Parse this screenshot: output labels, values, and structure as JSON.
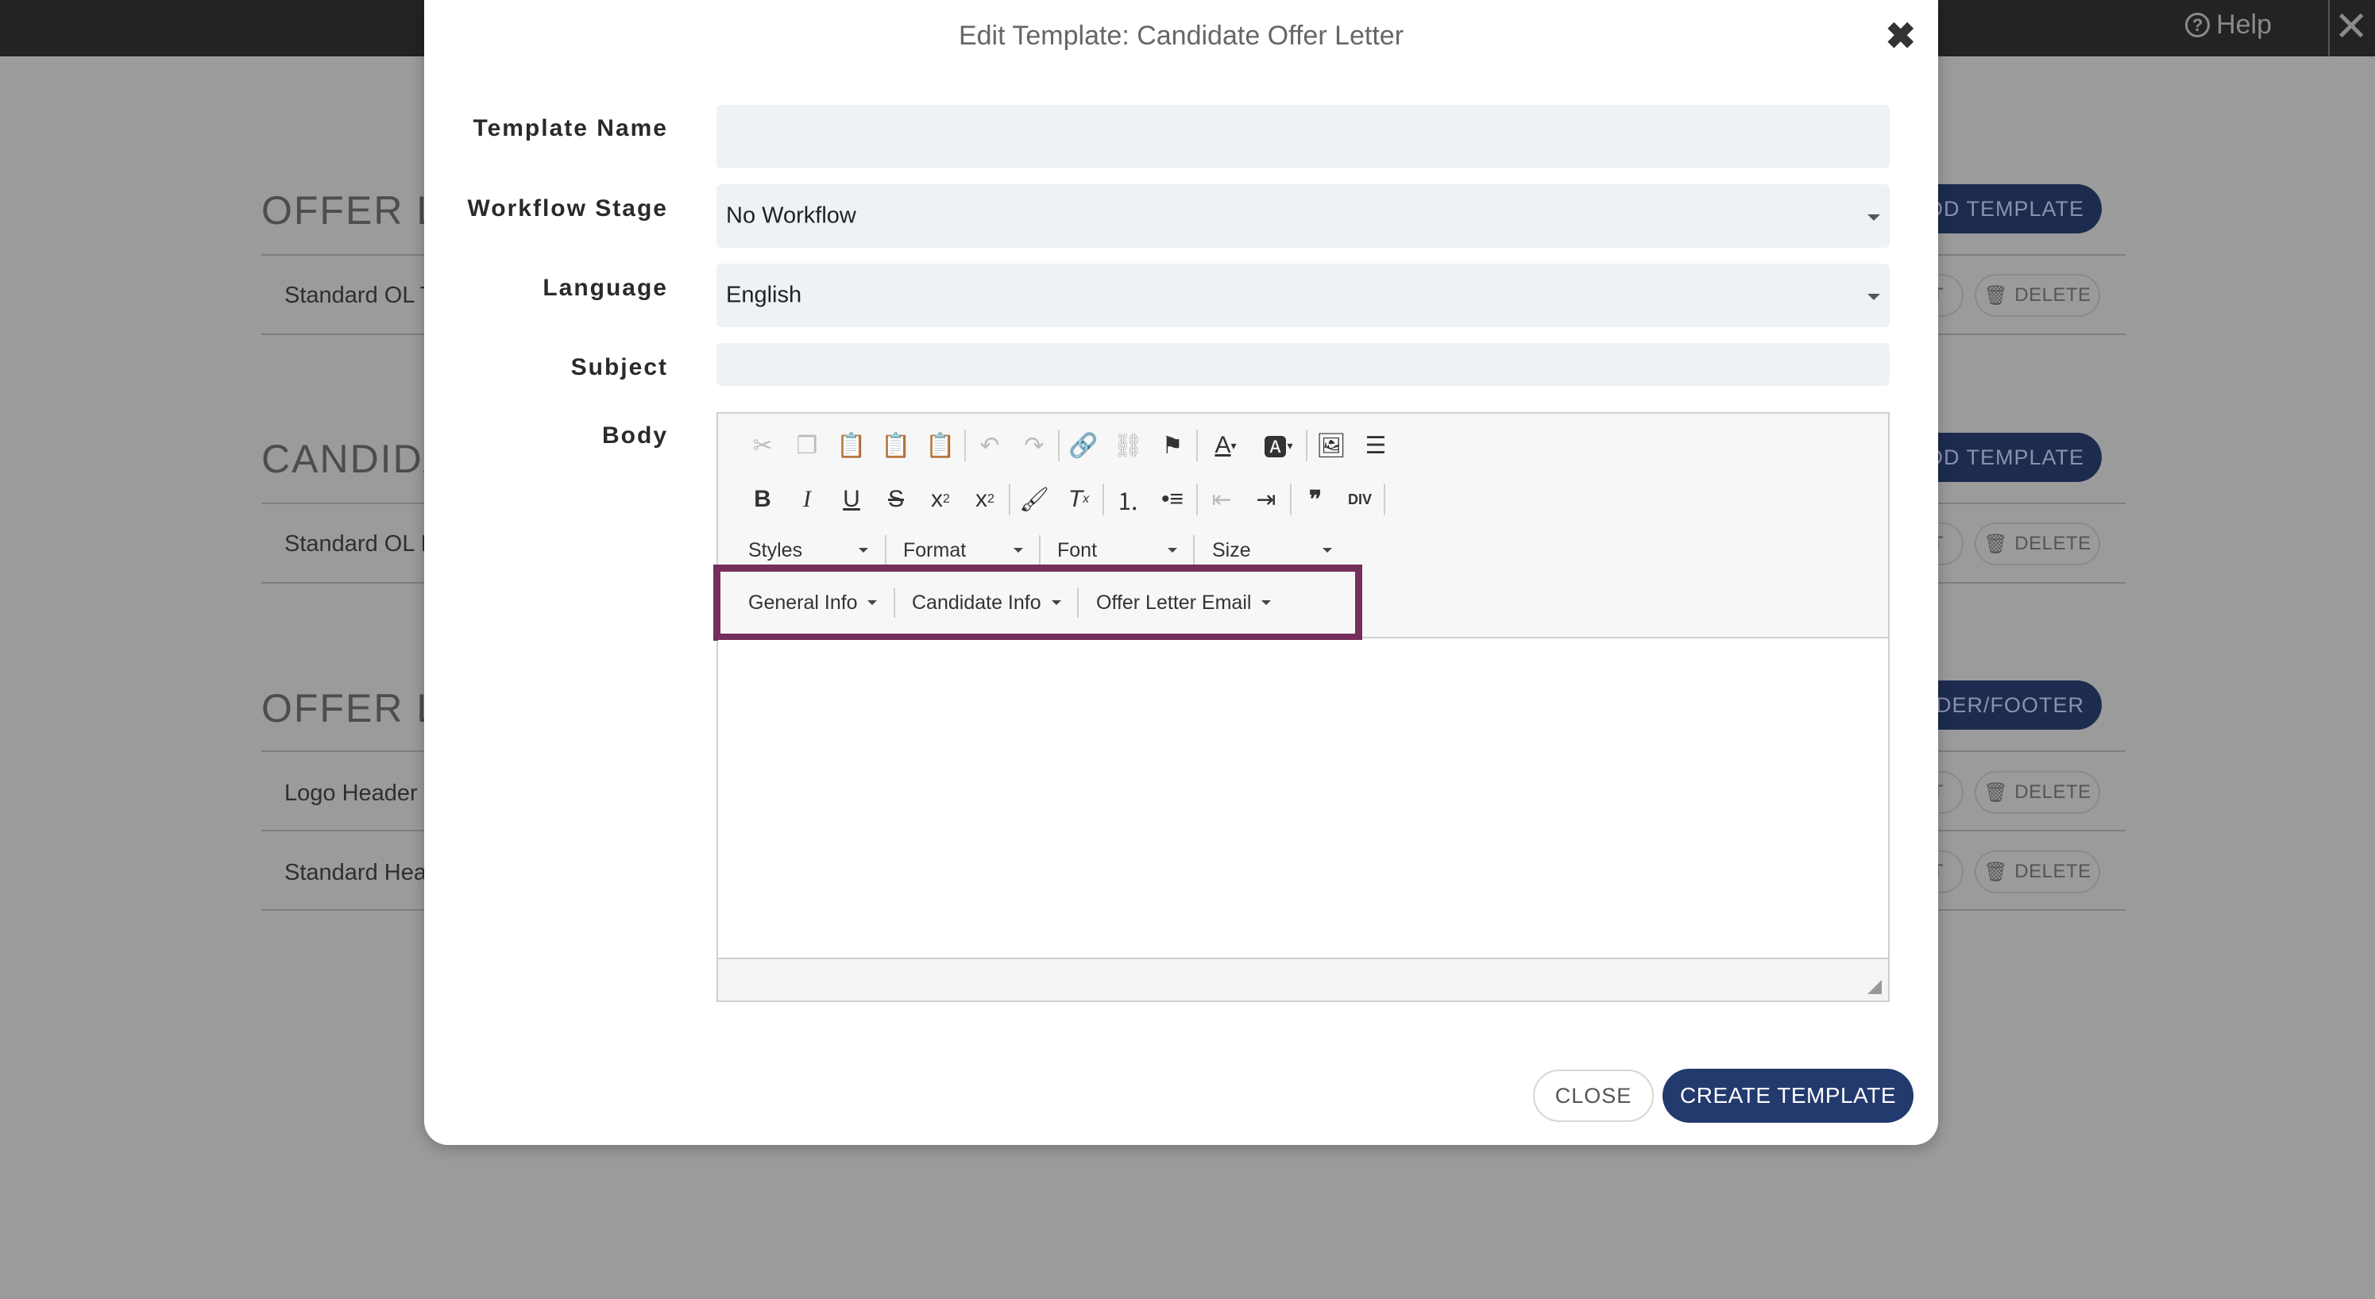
{
  "topbar": {
    "help_label": "Help",
    "help_icon": "question-circle-icon",
    "close_icon": "close-icon"
  },
  "background": {
    "sections": [
      {
        "title": "OFFER LE",
        "button_label": "DD TEMPLATE",
        "rows": [
          "Standard OL T"
        ]
      },
      {
        "title": "CANDIDA",
        "button_label": "DD TEMPLATE",
        "rows": [
          "Standard OL I"
        ]
      },
      {
        "title": "OFFER LE",
        "button_label": "ADER/FOOTER",
        "rows": [
          "Logo Header",
          "Standard Hea"
        ]
      }
    ],
    "edit_stub": "T",
    "delete_label": "DELETE"
  },
  "modal": {
    "title": "Edit Template: Candidate Offer Letter",
    "close_icon": "close-x-icon",
    "fields": {
      "template_name": {
        "label": "Template Name",
        "value": ""
      },
      "workflow_stage": {
        "label": "Workflow Stage",
        "value": "No Workflow"
      },
      "language": {
        "label": "Language",
        "value": "English"
      },
      "subject": {
        "label": "Subject",
        "value": ""
      },
      "body": {
        "label": "Body"
      }
    },
    "editor": {
      "row1_icons": [
        "cut-icon",
        "copy-icon",
        "paste-icon",
        "paste-text-icon",
        "paste-word-icon",
        "undo-icon",
        "redo-icon",
        "link-icon",
        "unlink-icon",
        "anchor-flag-icon",
        "text-color-icon",
        "background-color-icon",
        "image-icon",
        "horizontal-rule-icon"
      ],
      "row2_icons": [
        "bold-icon",
        "italic-icon",
        "underline-icon",
        "strikethrough-icon",
        "subscript-icon",
        "superscript-icon",
        "copy-format-icon",
        "remove-format-icon",
        "numbered-list-icon",
        "bulleted-list-icon",
        "outdent-icon",
        "indent-icon",
        "blockquote-icon",
        "div-container-icon"
      ],
      "combos": [
        "Styles",
        "Format",
        "Font",
        "Size"
      ],
      "placeholders": [
        "General Info",
        "Candidate Info",
        "Offer Letter Email"
      ],
      "highlight_color": "#742f5b"
    },
    "buttons": {
      "close": "CLOSE",
      "create": "CREATE TEMPLATE"
    }
  },
  "colors": {
    "primary": "#233a6e",
    "overlay": "#9b9b9b",
    "field_bg": "#eff2f5"
  }
}
